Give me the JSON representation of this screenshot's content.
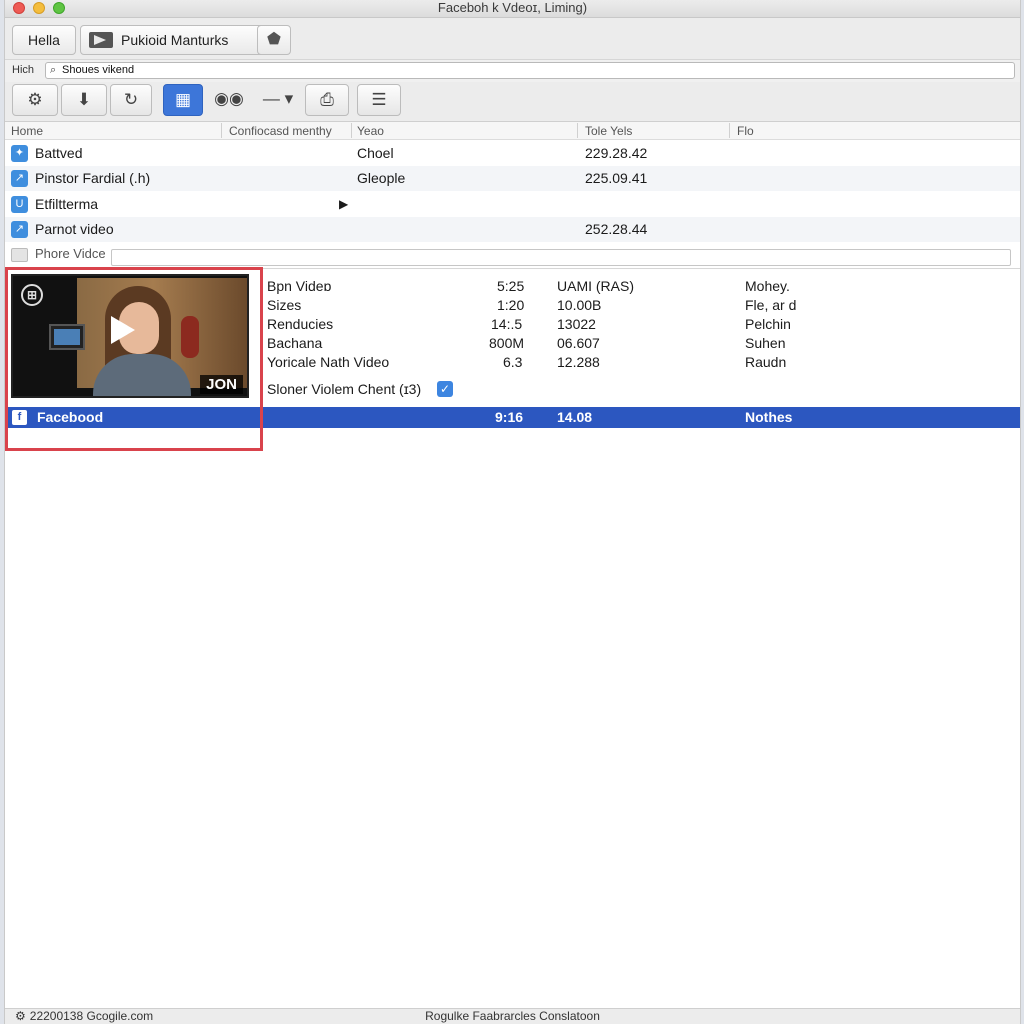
{
  "window": {
    "title": "Faceboh k Vdeoɪ, Liming)"
  },
  "tabs": {
    "hello": "Hella",
    "bookmarks": "Pukioid Manturks",
    "add_icon": "plugin-icon"
  },
  "search": {
    "label": "Hich",
    "value": "Shoues vikend"
  },
  "toolbar": {
    "buttons": [
      "settings-icon",
      "download-icon",
      "link-icon",
      "grid-icon",
      "view-icon",
      "separator-icon",
      "export-icon",
      "menu-icon"
    ],
    "active_color": "#3d76d9"
  },
  "list": {
    "headers": [
      "Home",
      "Confiocasd menthy",
      "Yeao",
      "Tole Yels",
      "Flo"
    ],
    "rows": [
      {
        "name": "Battved",
        "col2": "Choel",
        "col3": "229.28.42"
      },
      {
        "name": "Pinstor Fardial (.h)",
        "col2": "Gleople",
        "col3": "225.09.41"
      },
      {
        "name": "Etfiltterma",
        "col2": "",
        "col3": ""
      },
      {
        "name": "Parnot video",
        "col2": "",
        "col3": "252.28.44"
      }
    ],
    "phone_label": "Phore Vidce"
  },
  "video": {
    "tag": "JON",
    "details": [
      {
        "c1": "Bpn Videɒ",
        "c2": "5:25",
        "c3": "UAMI (RAS)",
        "c4": "Mohey."
      },
      {
        "c1": "Sizes",
        "c2": "1:20",
        "c3": "10.00B",
        "c4": "Fle, ar d"
      },
      {
        "c1": "Renducies",
        "c2": "14:.5",
        "c3": "13022",
        "c4": "Pelchin"
      },
      {
        "c1": "Bachana",
        "c2": "800M",
        "c3": "06.607",
        "c4": "Suhen"
      },
      {
        "c1": "Yoricale Nath Video",
        "c2": "6.3",
        "c3": "12.288",
        "c4": "Raudn"
      }
    ],
    "check_label": "Sloner Violem Chent (ɪ3)"
  },
  "facebook_row": {
    "name": "Facebood",
    "c2": "9:16",
    "c3": "14.08",
    "c4": "Nothes",
    "color": "#2c57c0"
  },
  "status": {
    "left": "22200138 Gcogile.com",
    "center": "Rogulke Faabrarcles Conslatoon"
  },
  "colors": {
    "highlight": "#d9434c",
    "accent": "#3d85e0"
  }
}
